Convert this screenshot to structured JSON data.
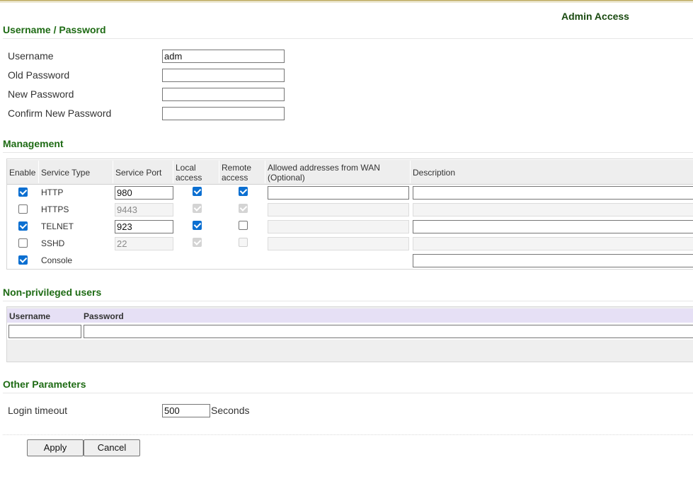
{
  "header": {
    "title": "Admin Access"
  },
  "credentials": {
    "section_title": "Username / Password",
    "username_label": "Username",
    "username_value": "adm",
    "old_password_label": "Old Password",
    "new_password_label": "New Password",
    "confirm_password_label": "Confirm New Password"
  },
  "management": {
    "section_title": "Management",
    "headers": {
      "enable": "Enable",
      "service_type": "Service Type",
      "service_port": "Service Port",
      "local_access_1": "Local",
      "local_access_2": "access",
      "remote_access_1": "Remote",
      "remote_access_2": "access",
      "allowed_1": "Allowed addresses from WAN",
      "allowed_2": "(Optional)",
      "description": "Description"
    },
    "rows": [
      {
        "enabled": true,
        "service": "HTTP",
        "port": "980",
        "local": true,
        "remote": true,
        "editable": true
      },
      {
        "enabled": false,
        "service": "HTTPS",
        "port": "9443",
        "local": true,
        "remote": true,
        "editable": false
      },
      {
        "enabled": true,
        "service": "TELNET",
        "port": "923",
        "local": true,
        "remote": false,
        "editable": true
      },
      {
        "enabled": false,
        "service": "SSHD",
        "port": "22",
        "local": true,
        "remote": false,
        "editable": false
      },
      {
        "enabled": true,
        "service": "Console"
      }
    ]
  },
  "non_privileged": {
    "section_title": "Non-privileged users",
    "username_header": "Username",
    "password_header": "Password"
  },
  "other": {
    "section_title": "Other Parameters",
    "login_timeout_label": "Login timeout",
    "login_timeout_value": "500",
    "unit": "Seconds"
  },
  "actions": {
    "apply": "Apply",
    "cancel": "Cancel"
  }
}
